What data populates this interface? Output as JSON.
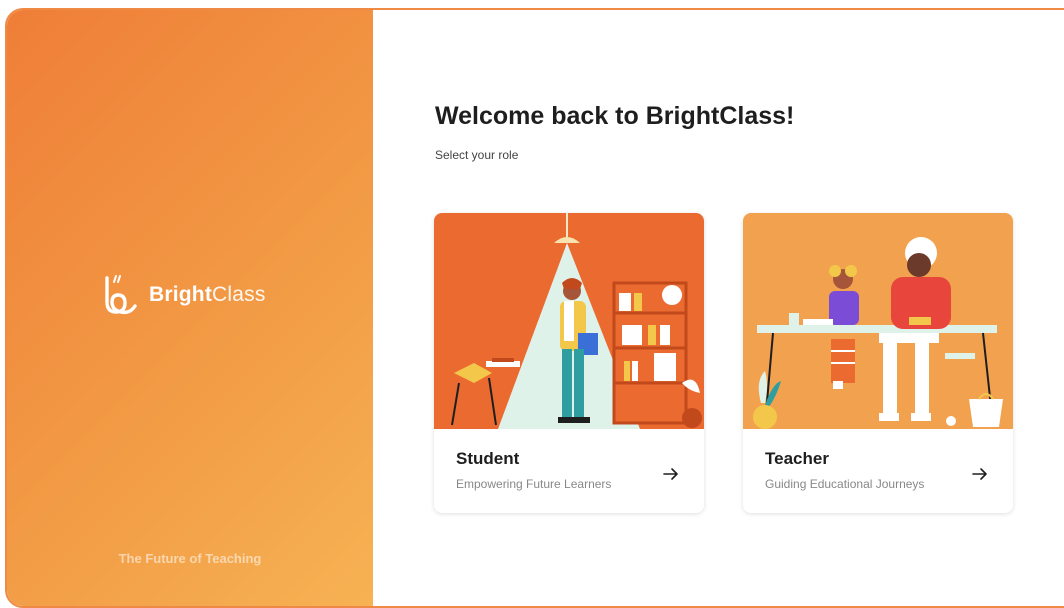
{
  "brand": {
    "name_bold": "Bright",
    "name_light": "Class",
    "tagline": "The Future of Teaching"
  },
  "header": {
    "title": "Welcome back to BrightClass!",
    "subtitle": "Select your role"
  },
  "roles": [
    {
      "title": "Student",
      "subtitle": "Empowering Future Learners",
      "icon": "arrow-right-icon",
      "bg": "#eb6a2f"
    },
    {
      "title": "Teacher",
      "subtitle": "Guiding Educational Journeys",
      "icon": "arrow-right-icon",
      "bg": "#f2a24e"
    }
  ],
  "colors": {
    "brand_gradient_start": "#ef7e37",
    "brand_gradient_end": "#f6b253",
    "text_dark": "#1e1e1e",
    "text_muted": "#888888"
  }
}
